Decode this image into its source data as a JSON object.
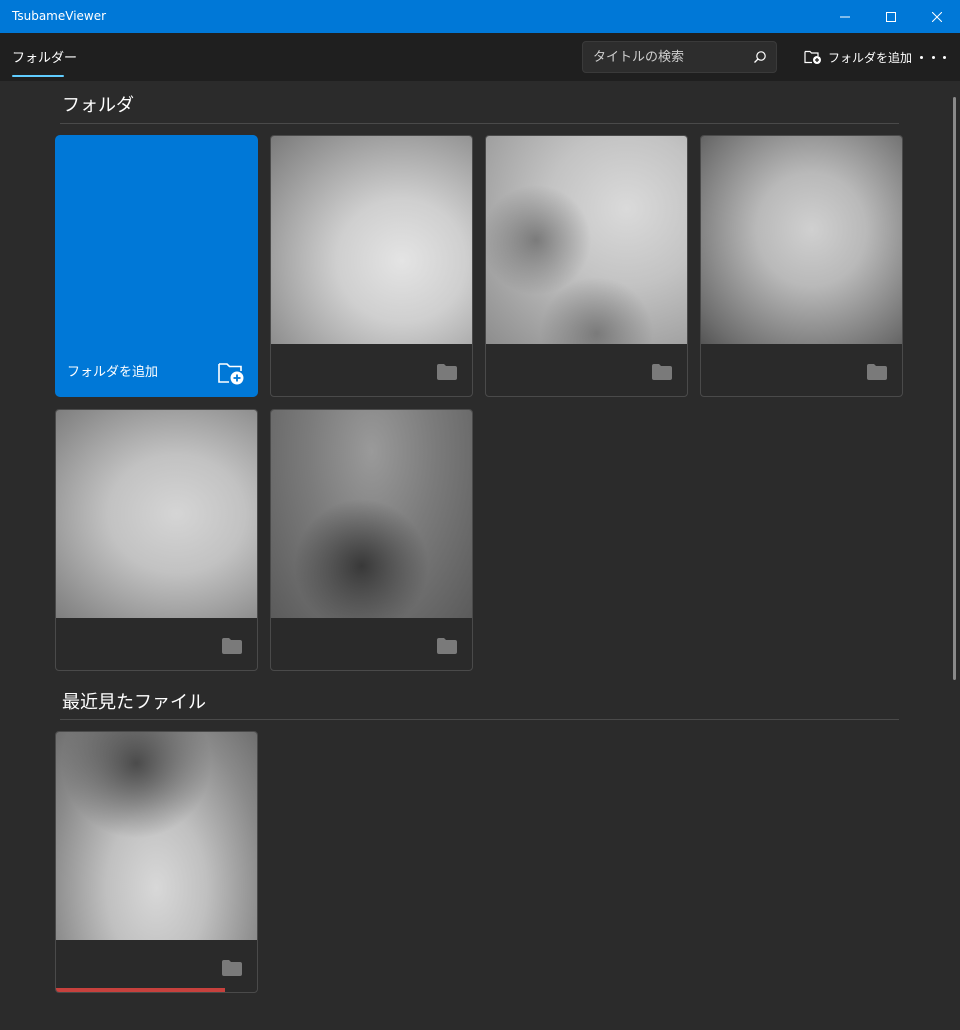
{
  "window": {
    "title": "TsubameViewer"
  },
  "toolbar": {
    "tab_label": "フォルダー",
    "search_placeholder": "タイトルの検索",
    "add_folder_label": "フォルダを追加"
  },
  "sections": {
    "folders_title": "フォルダ",
    "recent_title": "最近見たファイル"
  },
  "add_tile": {
    "label": "フォルダを追加"
  },
  "recent": {
    "progress": 0.84
  },
  "colors": {
    "accent": "#0078d7",
    "background": "#2b2b2b",
    "progress": "#c7413d"
  }
}
